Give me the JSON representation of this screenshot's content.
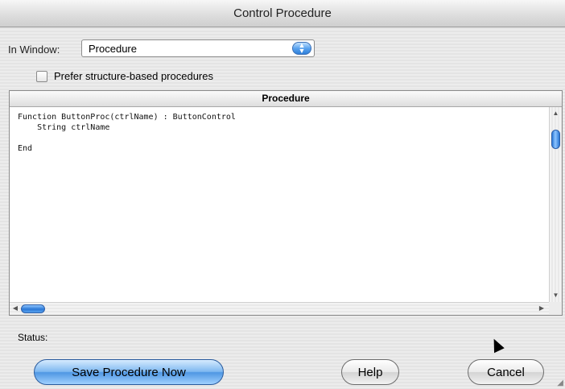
{
  "window": {
    "title": "Control Procedure"
  },
  "in_window": {
    "label": "In Window:",
    "selected": "Procedure"
  },
  "prefer_structure": {
    "label": "Prefer structure-based procedures",
    "checked": false
  },
  "editor": {
    "header": "Procedure",
    "code": "Function ButtonProc(ctrlName) : ButtonControl\n    String ctrlName\n\nEnd"
  },
  "status": {
    "label": "Status:",
    "value": ""
  },
  "buttons": {
    "save": "Save Procedure Now",
    "help": "Help",
    "cancel": "Cancel"
  },
  "colors": {
    "accent": "#4f97e3"
  }
}
